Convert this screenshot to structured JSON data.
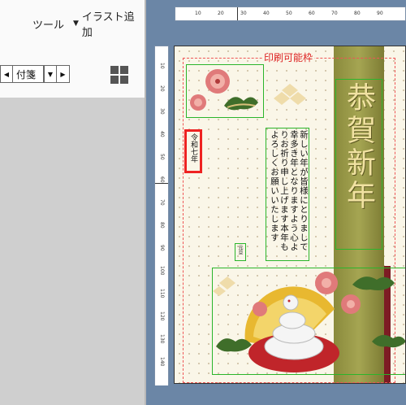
{
  "menu": {
    "tools_label": "ツール",
    "illustration_label": "イラスト追加",
    "illustration_caret": "▼"
  },
  "toolbar": {
    "prev_arrow": "◀",
    "next_arrow": "▶",
    "dropdown_arrow": "▼",
    "sticky_note_label": "付箋"
  },
  "ruler": {
    "h_ticks": [
      "10",
      "20",
      "30",
      "40",
      "50",
      "60",
      "70",
      "80",
      "90"
    ],
    "v_ticks": [
      "10",
      "20",
      "30",
      "40",
      "50",
      "60",
      "70",
      "80",
      "90",
      "100",
      "110",
      "120",
      "130",
      "140"
    ]
  },
  "card": {
    "print_area_label": "印刷可能枠",
    "greeting": "恭賀新年",
    "message": "新しい年が皆様にとりまして幸多き年となりますよう心よりお祈り申し上げます本年もよろしくお願いいたします",
    "era": "令和七年",
    "date_label": "元旦",
    "colors": {
      "frame": "#e55555",
      "selection": "#2bb52b",
      "highlight": "#e22222",
      "gold_band": "#a5a552",
      "red_ribbon": "#7d1c24",
      "greeting_text": "#f1e2a2"
    }
  }
}
